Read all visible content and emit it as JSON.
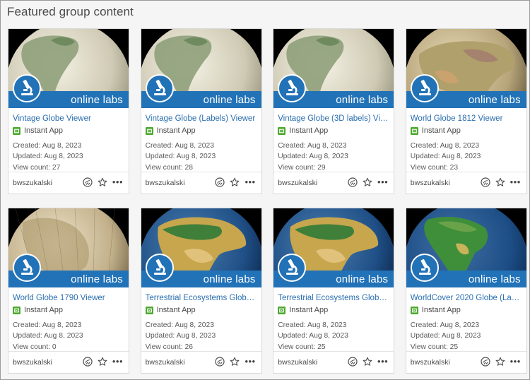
{
  "page": {
    "title": "Featured group content"
  },
  "colors": {
    "banner": "#2272b7",
    "link": "#2a6fb0",
    "app_icon": "#4fa830"
  },
  "items": [
    {
      "title": "Vintage Globe Viewer",
      "type": "Instant App",
      "banner_text": "online labs",
      "created": "Created: Aug 8, 2023",
      "updated": "Updated: Aug 8, 2023",
      "views": "View count: 27",
      "owner": "bwszukalski",
      "globe": "vintage-light"
    },
    {
      "title": "Vintage Globe (Labels) Viewer",
      "type": "Instant App",
      "banner_text": "online labs",
      "created": "Created: Aug 8, 2023",
      "updated": "Updated: Aug 8, 2023",
      "views": "View count: 28",
      "owner": "bwszukalski",
      "globe": "vintage-light"
    },
    {
      "title": "Vintage Globe (3D labels) Vie...",
      "type": "Instant App",
      "banner_text": "online labs",
      "created": "Created: Aug 8, 2023",
      "updated": "Updated: Aug 8, 2023",
      "views": "View count: 29",
      "owner": "bwszukalski",
      "globe": "vintage-light"
    },
    {
      "title": "World Globe 1812 Viewer",
      "type": "Instant App",
      "banner_text": "online labs",
      "created": "Created: Aug 8, 2023",
      "updated": "Updated: Aug 8, 2023",
      "views": "View count: 23",
      "owner": "bwszukalski",
      "globe": "antique-color"
    },
    {
      "title": "World Globe 1790 Viewer",
      "type": "Instant App",
      "banner_text": "online labs",
      "created": "Created: Aug 8, 2023",
      "updated": "Updated: Aug 8, 2023",
      "views": "View count: 0",
      "owner": "bwszukalski",
      "globe": "antique-sepia"
    },
    {
      "title": "Terrestrial Ecosystems Globe ...",
      "type": "Instant App",
      "banner_text": "online labs",
      "created": "Created: Aug 8, 2023",
      "updated": "Updated: Aug 8, 2023",
      "views": "View count: 26",
      "owner": "bwszukalski",
      "globe": "eco"
    },
    {
      "title": "Terrestrial Ecosystems Globe ...",
      "type": "Instant App",
      "banner_text": "online labs",
      "created": "Created: Aug 8, 2023",
      "updated": "Updated: Aug 8, 2023",
      "views": "View count: 25",
      "owner": "bwszukalski",
      "globe": "eco"
    },
    {
      "title": "WorldCover 2020 Globe (Lab...",
      "type": "Instant App",
      "banner_text": "online labs",
      "created": "Created: Aug 8, 2023",
      "updated": "Updated: Aug 8, 2023",
      "views": "View count: 25",
      "owner": "bwszukalski",
      "globe": "worldcover"
    }
  ]
}
